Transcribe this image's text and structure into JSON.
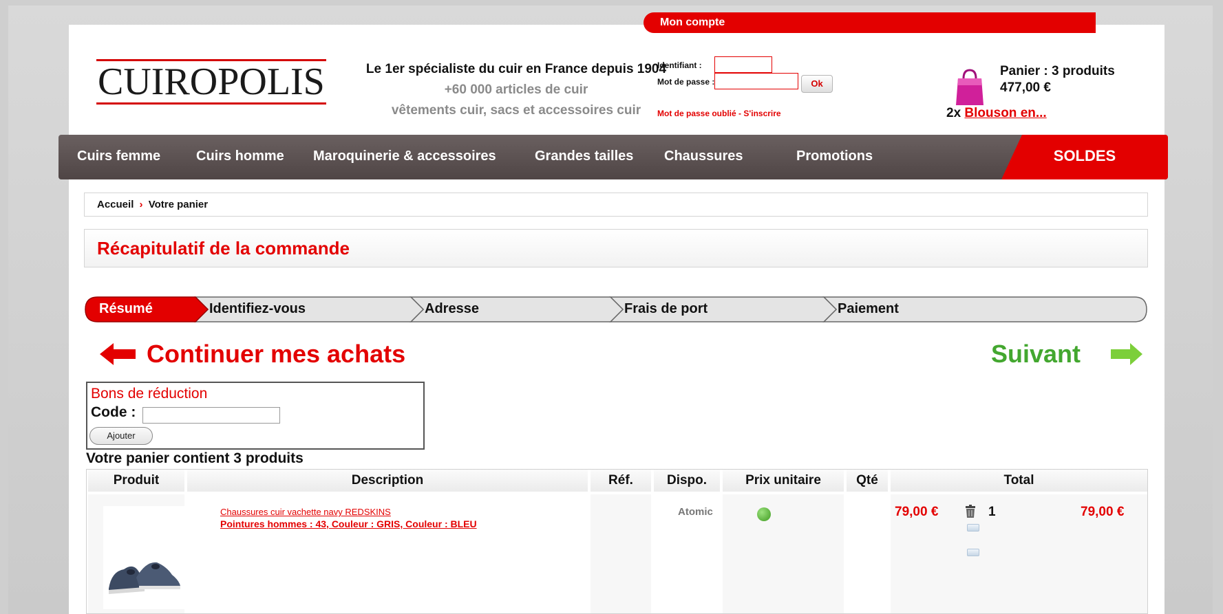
{
  "header": {
    "logo_text": "CUIROPOLIS",
    "tagline_main": "Le 1er spécialiste du cuir en France depuis 1904",
    "tagline_sub1": "+60 000 articles de cuir",
    "tagline_sub2": "vêtements cuir, sacs et accessoires cuir"
  },
  "account": {
    "title": "Mon compte",
    "login_label": "Identifiant :",
    "login_value": "",
    "password_label": "Mot de passe :",
    "password_value": "",
    "ok_label": "Ok",
    "forgot_link": "Mot de passe oublié",
    "separator": "-",
    "register_link": "S'inscrire"
  },
  "mini_cart": {
    "title": "Panier : 3 produits",
    "total": "477,00 €",
    "item_qty": "2x",
    "item_link": "Blouson en..."
  },
  "nav": {
    "items": [
      "Cuirs femme",
      "Cuirs homme",
      "Maroquinerie & accessoires",
      "Grandes tailles",
      "Chaussures",
      "Promotions"
    ],
    "soldes": "SOLDES"
  },
  "breadcrumb": {
    "home": "Accueil",
    "separator": "›",
    "current": "Votre panier"
  },
  "page_title": "Récapitulatif de la commande",
  "steps": [
    {
      "label": "Résumé",
      "active": true
    },
    {
      "label": "Identifiez-vous",
      "active": false
    },
    {
      "label": "Adresse",
      "active": false
    },
    {
      "label": "Frais de port",
      "active": false
    },
    {
      "label": "Paiement",
      "active": false
    }
  ],
  "actions": {
    "continue_label": "Continuer mes achats",
    "next_label": "Suivant"
  },
  "coupon": {
    "title": "Bons de réduction",
    "code_label": "Code :",
    "code_value": "",
    "add_label": "Ajouter"
  },
  "cart_summary": "Votre panier contient 3 produits",
  "table": {
    "headers": [
      "Produit",
      "Description",
      "Réf.",
      "Dispo.",
      "Prix unitaire",
      "Qté",
      "Total"
    ],
    "rows": [
      {
        "name": "Chaussures cuir vachette navy REDSKINS",
        "options": "Pointures hommes : 43, Couleur : GRIS, Couleur : BLEU",
        "ref": "Atomic",
        "unit_price": "79,00 €",
        "qty": "1",
        "total": "79,00 €"
      }
    ]
  },
  "colors": {
    "brand_red": "#e30000",
    "nav_gray": "#5a5050",
    "next_green": "#43a72f",
    "available_green": "#4aa82a"
  }
}
